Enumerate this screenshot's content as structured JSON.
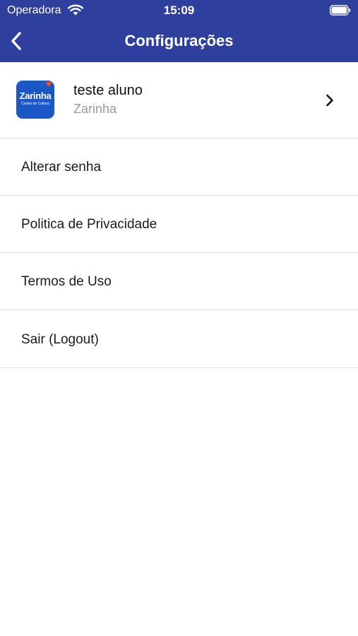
{
  "status_bar": {
    "carrier": "Operadora",
    "time": "15:09"
  },
  "nav": {
    "title": "Configurações",
    "back_icon": "chevron-left-icon"
  },
  "profile": {
    "name": "teste aluno",
    "school": "Zarinha",
    "logo_title": "Zarinha",
    "logo_subtitle": "Centro de Cultura"
  },
  "menu": {
    "items": [
      {
        "label": "Alterar senha"
      },
      {
        "label": "Politica de Privacidade"
      },
      {
        "label": "Termos de Uso"
      },
      {
        "label": "Sair (Logout)"
      }
    ]
  },
  "colors": {
    "header": "#2f3f9e",
    "logo_background": "#1c57c8",
    "logo_accent": "#e8532f",
    "secondary_text": "#9a9a9a",
    "divider": "#dedede"
  }
}
